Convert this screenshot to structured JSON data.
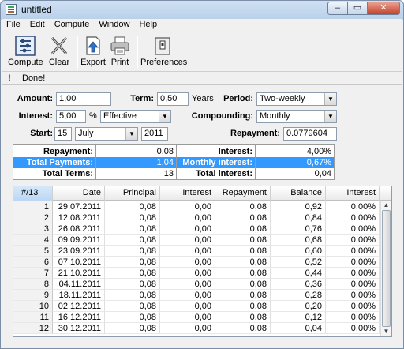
{
  "window": {
    "title": "untitled",
    "min": "‒",
    "max": "▭",
    "close": "✕"
  },
  "menu": [
    "File",
    "Edit",
    "Compute",
    "Window",
    "Help"
  ],
  "toolbar": {
    "compute": "Compute",
    "clear": "Clear",
    "export": "Export",
    "print": "Print",
    "preferences": "Preferences"
  },
  "status": {
    "icon": "!",
    "message": "Done!"
  },
  "form": {
    "amount_label": "Amount:",
    "amount_value": "1,00",
    "term_label": "Term:",
    "term_value": "0,50",
    "term_unit": "Years",
    "period_label": "Period:",
    "period_value": "Two-weekly",
    "interest_label": "Interest:",
    "interest_value": "5,00",
    "interest_unit": "%",
    "interest_type": "Effective",
    "compounding_label": "Compounding:",
    "compounding_value": "Monthly",
    "start_label": "Start:",
    "start_day": "15",
    "start_month": "July",
    "start_year": "2011",
    "repayment_label": "Repayment:",
    "repayment_value": "0.0779604"
  },
  "summary": {
    "repayment_label": "Repayment:",
    "repayment_value": "0,08",
    "interest_label": "Interest:",
    "interest_value": "4,00%",
    "total_payments_label": "Total Payments:",
    "total_payments_value": "1,04",
    "monthly_interest_label": "Monthly interest:",
    "monthly_interest_value": "0,67%",
    "total_terms_label": "Total Terms:",
    "total_terms_value": "13",
    "total_interest_label": "Total interest:",
    "total_interest_value": "0,04"
  },
  "grid": {
    "columns": [
      "#/13",
      "Date",
      "Principal",
      "Interest",
      "Repayment",
      "Balance",
      "Interest"
    ],
    "rows": [
      [
        "1",
        "29.07.2011",
        "0,08",
        "0,00",
        "0,08",
        "0,92",
        "0,00%"
      ],
      [
        "2",
        "12.08.2011",
        "0,08",
        "0,00",
        "0,08",
        "0,84",
        "0,00%"
      ],
      [
        "3",
        "26.08.2011",
        "0,08",
        "0,00",
        "0,08",
        "0,76",
        "0,00%"
      ],
      [
        "4",
        "09.09.2011",
        "0,08",
        "0,00",
        "0,08",
        "0,68",
        "0,00%"
      ],
      [
        "5",
        "23.09.2011",
        "0,08",
        "0,00",
        "0,08",
        "0,60",
        "0,00%"
      ],
      [
        "6",
        "07.10.2011",
        "0,08",
        "0,00",
        "0,08",
        "0,52",
        "0,00%"
      ],
      [
        "7",
        "21.10.2011",
        "0,08",
        "0,00",
        "0,08",
        "0,44",
        "0,00%"
      ],
      [
        "8",
        "04.11.2011",
        "0,08",
        "0,00",
        "0,08",
        "0,36",
        "0,00%"
      ],
      [
        "9",
        "18.11.2011",
        "0,08",
        "0,00",
        "0,08",
        "0,28",
        "0,00%"
      ],
      [
        "10",
        "02.12.2011",
        "0,08",
        "0,00",
        "0,08",
        "0,20",
        "0,00%"
      ],
      [
        "11",
        "16.12.2011",
        "0,08",
        "0,00",
        "0,08",
        "0,12",
        "0,00%"
      ],
      [
        "12",
        "30.12.2011",
        "0,08",
        "0,00",
        "0,08",
        "0,04",
        "0,00%"
      ]
    ]
  }
}
